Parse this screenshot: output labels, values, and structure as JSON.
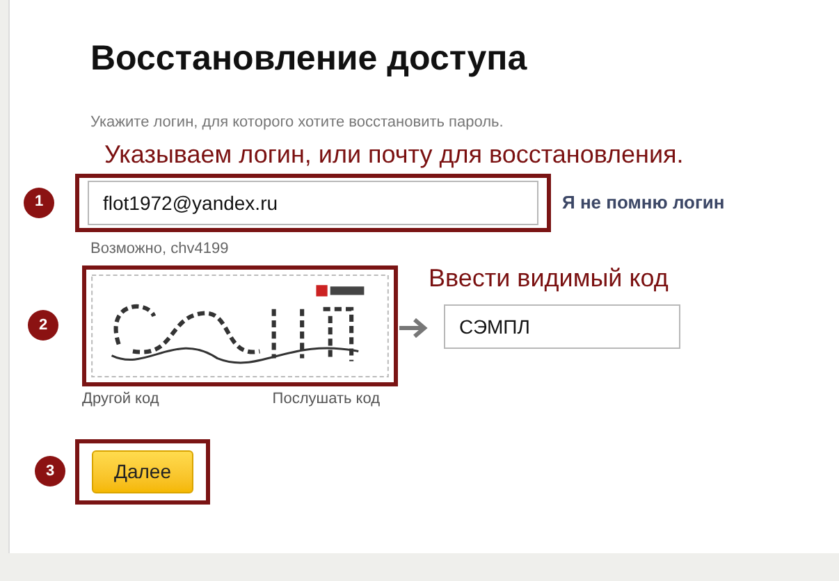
{
  "title": "Восстановление доступа",
  "hint": "Укажите логин, для которого хотите восстановить пароль.",
  "annotations": [
    {
      "number": "1",
      "text": "Указываем логин, или почту для восстановления."
    },
    {
      "number": "2",
      "text": "Ввести видимый код"
    },
    {
      "number": "3"
    }
  ],
  "login": {
    "value": "flot1972@yandex.ru",
    "link": "Я не помню логин",
    "suggestion": "Возможно, chv4199"
  },
  "captcha": {
    "image": {
      "kind": "picture"
    },
    "value": "СЭМПЛ",
    "links": [
      "Другой код",
      "Послушать код"
    ]
  },
  "submit": "Далее"
}
